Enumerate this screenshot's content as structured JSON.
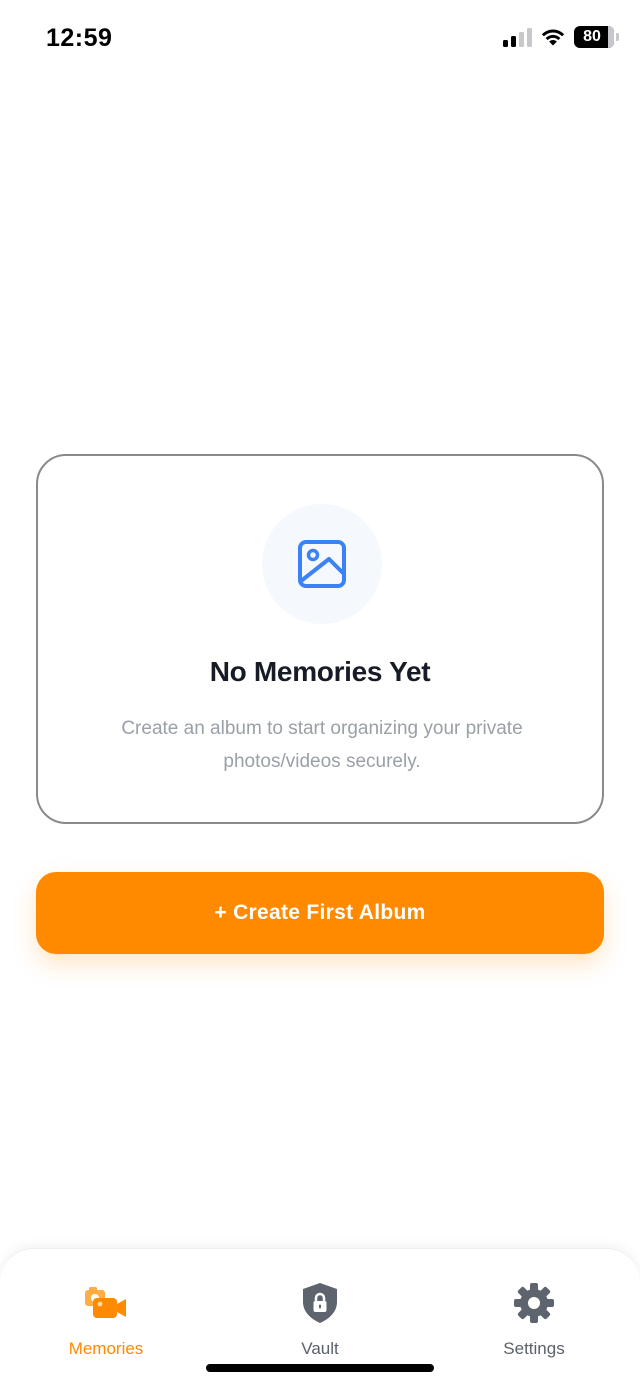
{
  "status_bar": {
    "time": "12:59",
    "battery": "80"
  },
  "empty_state": {
    "title": "No Memories Yet",
    "description": "Create an album to start organizing your private photos/videos securely.",
    "icon": "image-icon"
  },
  "cta": {
    "label": "+ Create First Album"
  },
  "tabs": [
    {
      "label": "Memories",
      "icon": "camera-video-icon",
      "active": true
    },
    {
      "label": "Vault",
      "icon": "shield-lock-icon",
      "active": false
    },
    {
      "label": "Settings",
      "icon": "gear-icon",
      "active": false
    }
  ],
  "colors": {
    "accent": "#ff8a00",
    "icon_blue": "#3b82f6",
    "title": "#161b26",
    "muted_text": "#9aa0a8",
    "tab_inactive": "#5b616b"
  }
}
